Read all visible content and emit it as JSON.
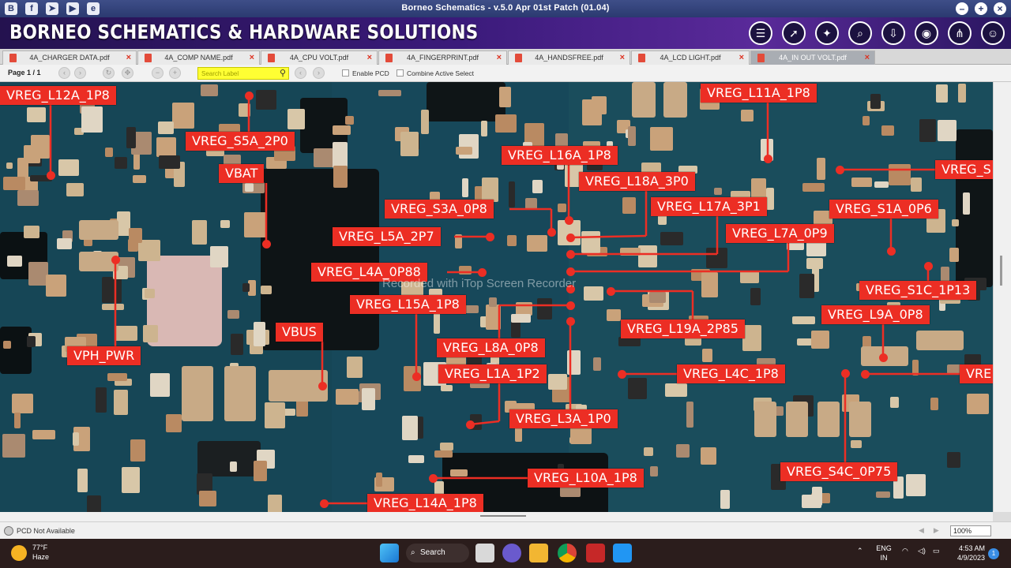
{
  "window": {
    "title": "Borneo Schematics - v.5.0 Apr 01st Patch (01.04)",
    "left_icons": [
      "borneo-logo-icon",
      "facebook-icon",
      "telegram-icon",
      "youtube-icon",
      "browser-icon"
    ],
    "buttons": [
      "minimize-icon",
      "maximize-icon",
      "close-icon"
    ]
  },
  "banner": {
    "title": "BORNEO SCHEMATICS & HARDWARE SOLUTIONS",
    "icons": [
      "schematic-list-icon",
      "pointer-icon",
      "magic-wand-icon",
      "zoom-search-icon",
      "download-icon",
      "camera-icon",
      "share-icon",
      "user-icon"
    ]
  },
  "tabs": [
    {
      "label": "4A_CHARGER DATA.pdf",
      "active": false
    },
    {
      "label": "4A_COMP NAME.pdf",
      "active": false
    },
    {
      "label": "4A_CPU VOLT.pdf",
      "active": false
    },
    {
      "label": "4A_FINGERPRINT.pdf",
      "active": false
    },
    {
      "label": "4A_HANDSFREE.pdf",
      "active": false
    },
    {
      "label": "4A_LCD LIGHT.pdf",
      "active": false
    },
    {
      "label": "4A_IN OUT VOLT.pdf",
      "active": true
    }
  ],
  "toolbar": {
    "page": "Page 1 / 1",
    "search_placeholder": "Search Label",
    "enable_pcd": "Enable PCD",
    "combine_select": "Combine Active Select"
  },
  "board": {
    "watermark": "Recorded with iTop Screen Recorder",
    "labels": [
      "VREG_L12A_1P8",
      "VREG_S5A_2P0",
      "VBAT",
      "VPH_PWR",
      "VBUS",
      "VREG_S3A_0P8",
      "VREG_L5A_2P7",
      "VREG_L4A_0P88",
      "VREG_L15A_1P8",
      "VREG_L8A_0P8",
      "VREG_L1A_1P2",
      "VREG_L3A_1P0",
      "VREG_L10A_1P8",
      "VREG_L14A_1P8",
      "VREG_L16A_1P8",
      "VREG_L18A_3P0",
      "VREG_L17A_3P1",
      "VREG_L7A_0P9",
      "VREG_L19A_2P85",
      "VREG_L4C_1P8",
      "VREG_L11A_1P8",
      "VREG_S",
      "VREG_S1A_0P6",
      "VREG_S1C_1P13",
      "VREG_L9A_0P8",
      "VRE",
      "VREG_S4C_0P75"
    ]
  },
  "status": {
    "text": "PCD Not Available",
    "zoom": "100%"
  },
  "taskbar": {
    "weather_temp": "77°F",
    "weather_desc": "Haze",
    "search": "Search",
    "lang1": "ENG",
    "lang2": "IN",
    "time": "4:53 AM",
    "date": "4/9/2023",
    "notifications": "1"
  }
}
